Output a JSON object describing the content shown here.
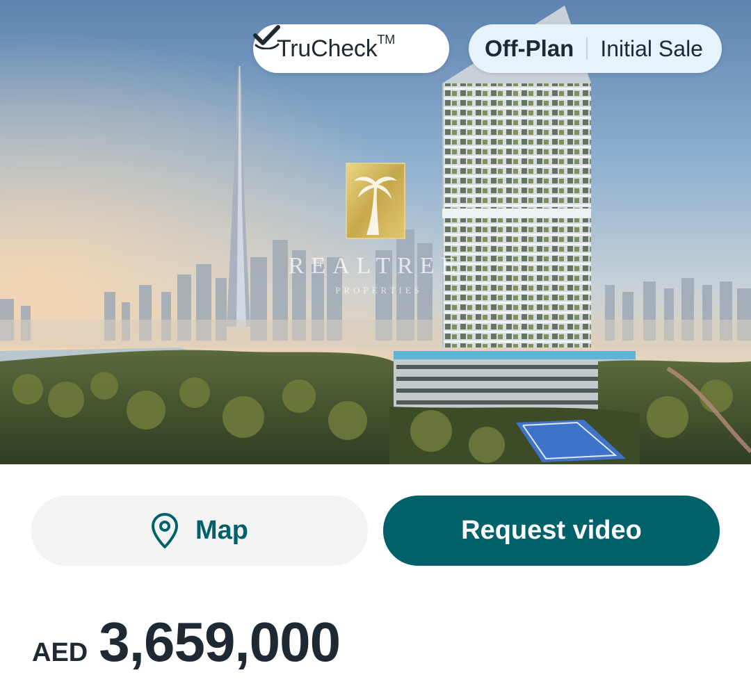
{
  "hero": {
    "badge_trucheck": {
      "label": "TruCheck",
      "tm": "TM",
      "icon": "check-badge-icon"
    },
    "badge_status": {
      "primary": "Off-Plan",
      "secondary": "Initial Sale"
    },
    "watermark": {
      "name": "REALTREE",
      "sub": "PROPERTIES",
      "logo": "palm-tree-logo"
    }
  },
  "actions": {
    "map_label": "Map",
    "map_icon": "location-pin-icon",
    "video_label": "Request video"
  },
  "price": {
    "currency": "AED",
    "amount": "3,659,000"
  },
  "colors": {
    "accent": "#01616a",
    "status_pill": "#e6f3fb",
    "map_button": "#f3f3f3"
  }
}
